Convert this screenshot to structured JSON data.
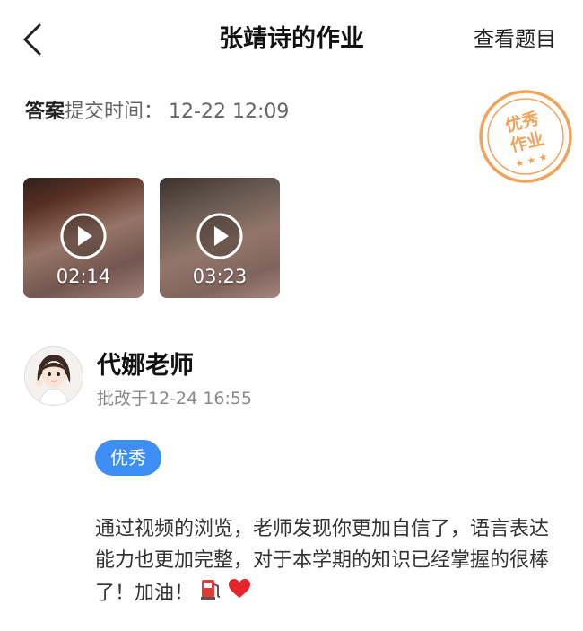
{
  "header": {
    "title": "张靖诗的作业",
    "view_questions": "查看题目"
  },
  "submission": {
    "answer_label": "答案",
    "submit_label": "提交时间：",
    "submit_time": "12-22 12:09"
  },
  "stamp": {
    "line1": "优秀",
    "line2": "作业",
    "color": "#f0a35a"
  },
  "videos": [
    {
      "duration": "02:14"
    },
    {
      "duration": "03:23"
    }
  ],
  "teacher": {
    "name": "代娜老师",
    "graded_label": "批改于",
    "graded_time": "12-24 16:55"
  },
  "grade_badge": {
    "label": "优秀",
    "color": "#3d8ef5"
  },
  "comment": {
    "text": "通过视频的浏览，老师发现你更加自信了，语言表达能力也更加完整，对于本学期的知识已经掌握的很棒了！加油！"
  },
  "icons": [
    "back-icon",
    "play-icon",
    "fuel-pump-icon",
    "heart-icon"
  ]
}
